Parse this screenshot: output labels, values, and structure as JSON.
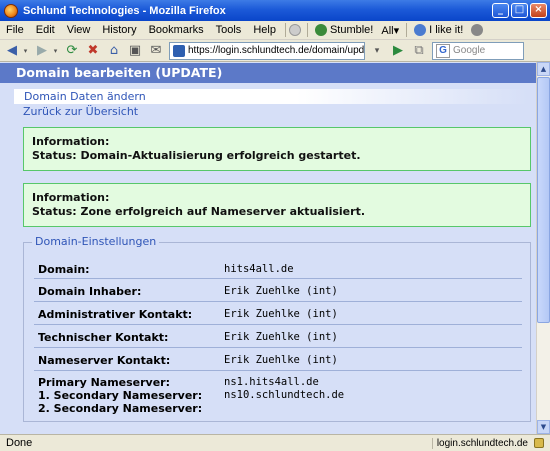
{
  "window": {
    "title": "Schlund Technologies - Mozilla Firefox"
  },
  "menubar": {
    "items": [
      "File",
      "Edit",
      "View",
      "History",
      "Bookmarks",
      "Tools",
      "Help"
    ],
    "stumble": "Stumble!",
    "all": "All▾",
    "ilike": "I like it!"
  },
  "navbar": {
    "url": "https://login.schlundtech.de/domain/upda",
    "search_placeholder": "Google"
  },
  "page": {
    "header": "Domain bearbeiten (UPDATE)",
    "tab": "Domain Daten ändern",
    "back_link": "Zurück zur Übersicht",
    "info1": {
      "label": "Information:",
      "text": "Status: Domain-Aktualisierung erfolgreich gestartet."
    },
    "info2": {
      "label": "Information:",
      "text": "Status: Zone erfolgreich auf Nameserver aktualisiert."
    },
    "settings": {
      "legend": "Domain-Einstellungen",
      "rows": [
        {
          "label": "Domain:",
          "value": "hits4all.de"
        },
        {
          "label": "Domain Inhaber:",
          "value": "Erik Zuehlke (int)"
        },
        {
          "label": "Administrativer Kontakt:",
          "value": "Erik Zuehlke (int)"
        },
        {
          "label": "Technischer Kontakt:",
          "value": "Erik Zuehlke (int)"
        },
        {
          "label": "Nameserver Kontakt:",
          "value": "Erik Zuehlke (int)"
        }
      ],
      "nameservers": [
        {
          "label": "Primary Nameserver:",
          "value": "ns1.hits4all.de"
        },
        {
          "label": "1. Secondary Nameserver:",
          "value": "ns10.schlundtech.de"
        },
        {
          "label": "2. Secondary Nameserver:",
          "value": ""
        }
      ]
    }
  },
  "statusbar": {
    "text": "Done",
    "url": "login.schlundtech.de"
  }
}
